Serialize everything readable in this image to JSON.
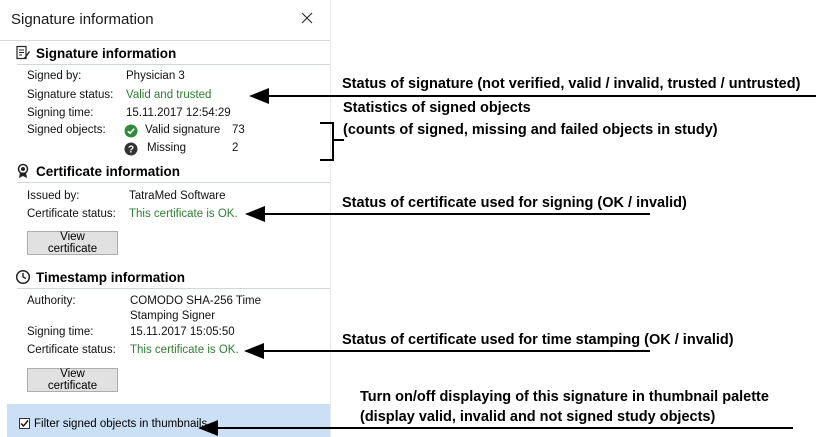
{
  "window": {
    "title": "Signature information"
  },
  "signature": {
    "heading": "Signature information",
    "signed_by_label": "Signed by:",
    "signed_by_value": "Physician 3",
    "status_label": "Signature status:",
    "status_value": "Valid and trusted",
    "time_label": "Signing time:",
    "time_value": "15.11.2017 12:54:29",
    "objects_label": "Signed objects:",
    "objects": [
      {
        "label": "Valid signature",
        "count": "73",
        "icon": "check-circle-icon"
      },
      {
        "label": "Missing",
        "count": "2",
        "icon": "question-circle-icon"
      }
    ]
  },
  "certificate": {
    "heading": "Certificate information",
    "issued_label": "Issued by:",
    "issued_value": "TatraMed Software",
    "status_label": "Certificate status:",
    "status_value": "This certificate is OK.",
    "button": "View certificate"
  },
  "timestamp": {
    "heading": "Timestamp information",
    "authority_label": "Authority:",
    "authority_line1": "COMODO SHA-256 Time",
    "authority_line2": "Stamping Signer",
    "time_label": "Signing time:",
    "time_value": "15.11.2017 15:05:50",
    "status_label": "Certificate status:",
    "status_value": "This certificate is OK.",
    "button": "View certificate"
  },
  "filter": {
    "label": "Filter signed objects in thumbnails",
    "checked": true
  },
  "annotations": {
    "sig_status": "Status of signature (not verified, valid / invalid, trusted / untrusted)",
    "stats_line1": "Statistics of signed objects",
    "stats_line2": "(counts of signed, missing and failed objects in study)",
    "cert_status": "Status of certificate used for signing (OK / invalid)",
    "ts_status": "Status of certificate used for time stamping (OK / invalid)",
    "filter_line1": "Turn on/off displaying of this signature in thumbnail palette",
    "filter_line2": "(display valid, invalid and not signed study objects)"
  },
  "colors": {
    "accent_green": "#2e7d32",
    "filter_bg": "#cce0f5"
  }
}
